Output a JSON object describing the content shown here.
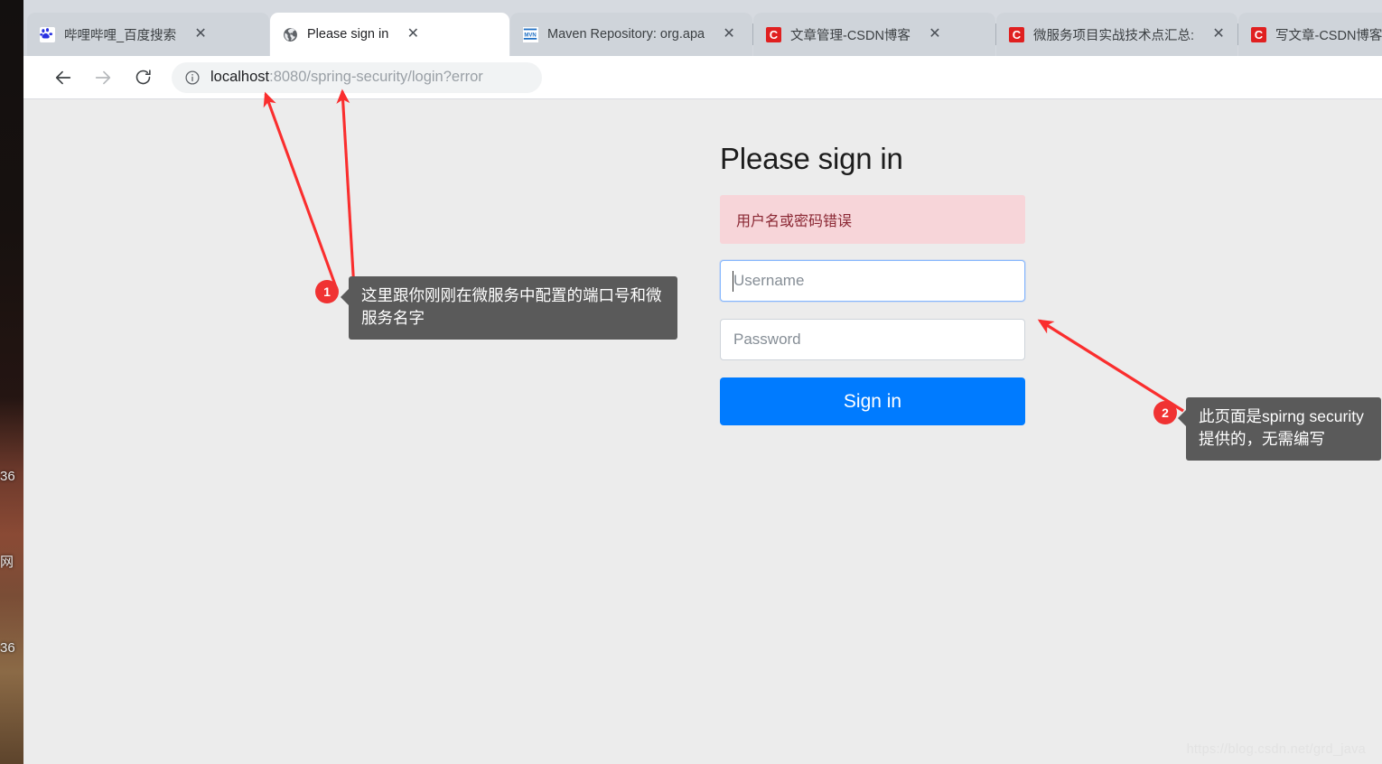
{
  "window": {
    "new_tab_label": "+"
  },
  "tabs": [
    {
      "title": "哔哩哔哩_百度搜索",
      "favicon": "baidu-icon",
      "active": false,
      "close_label": "✕"
    },
    {
      "title": "Please sign in",
      "favicon": "globe-icon",
      "active": true,
      "close_label": "✕"
    },
    {
      "title": "Maven Repository: org.apa",
      "favicon": "maven-icon",
      "active": false,
      "close_label": "✕"
    },
    {
      "title": "文章管理-CSDN博客",
      "favicon": "csdn-icon",
      "active": false,
      "close_label": "✕"
    },
    {
      "title": "微服务项目实战技术点汇总:",
      "favicon": "csdn-icon",
      "active": false,
      "close_label": "✕"
    },
    {
      "title": "写文章-CSDN博客",
      "favicon": "csdn-icon",
      "active": false,
      "close_label": "✕"
    }
  ],
  "toolbar": {
    "back_label": "←",
    "forward_label": "→",
    "reload_label": "↻",
    "url_host": "localhost",
    "url_rest": ":8080/spring-security/login?error",
    "url_full": "localhost:8080/spring-security/login?error",
    "site_info_label": "ⓘ"
  },
  "page": {
    "title": "Please sign in",
    "error_message": "用户名或密码错误",
    "username_placeholder": "Username",
    "username_value": "",
    "password_placeholder": "Password",
    "password_value": "",
    "signin_label": "Sign in",
    "watermark": "https://blog.csdn.net/grd_java"
  },
  "annotations": [
    {
      "number": "1",
      "text": "这里跟你刚刚在微服务中配置的端口号和微服务名字"
    },
    {
      "number": "2",
      "text": "此页面是spirng security提供的，无需编写"
    }
  ],
  "desktop": {
    "line1": "36",
    "line2": "网",
    "line3": "36"
  },
  "colors": {
    "accent_blue": "#007bff",
    "error_bg": "#f7d5d9",
    "error_text": "#8a2733",
    "arrow_red": "#fa2e2e",
    "callout_bg": "#5a5a5a",
    "page_bg": "#ececec",
    "tabstrip_bg": "#d6dae0"
  }
}
